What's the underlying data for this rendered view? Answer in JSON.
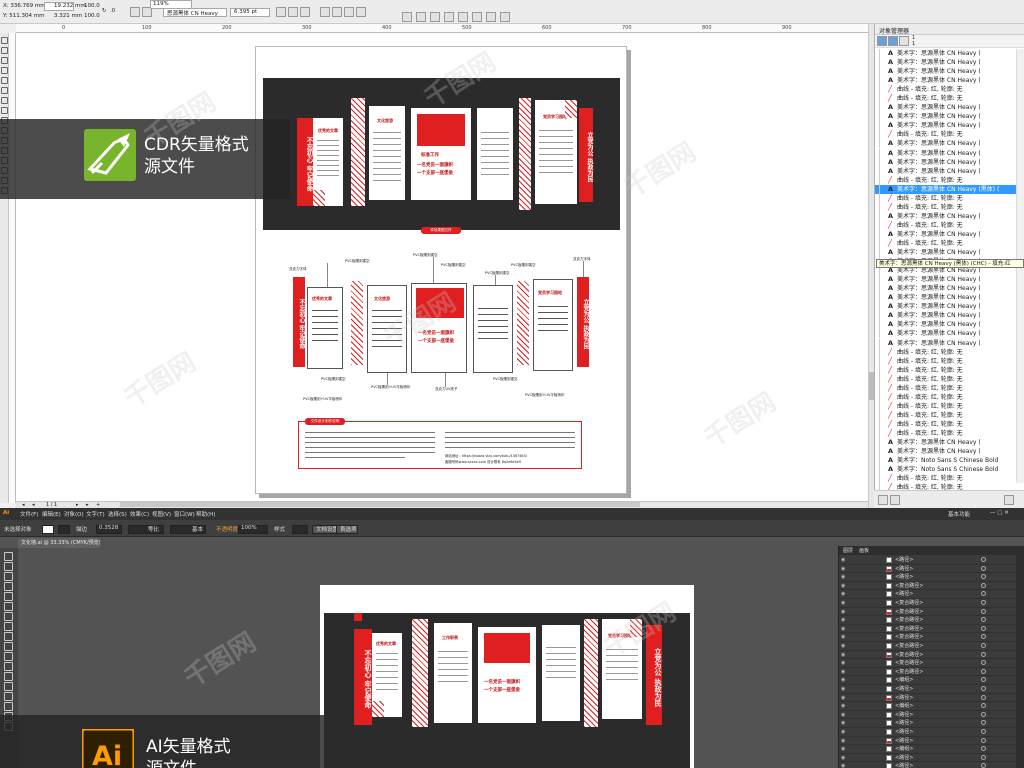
{
  "cdr": {
    "property_bar": {
      "pos_x": "X: 336.769 mm",
      "pos_y": "Y: 511.304 mm",
      "size_w": "19.232 mm",
      "size_h": "3.321 mm",
      "scale_w": "100.0",
      "scale_h": "100.0",
      "rotation": ".0",
      "font_name": "思源黑体 CN Heavy",
      "font_size": "6.395 pt",
      "zoom": "119%"
    },
    "ruler_h": [
      "0",
      "100",
      "200",
      "300",
      "400",
      "500",
      "600",
      "700",
      "800",
      "900"
    ],
    "ruler_v_mm": [
      "800",
      "700",
      "600",
      "500",
      "400",
      "300",
      "200",
      "100"
    ],
    "page_nav": {
      "current": "1 / 1"
    },
    "design": {
      "top_left_vertical": "不忘初心 牢记使命",
      "top_right_vertical": "立党为公 执政为民",
      "panel_titles": [
        "优秀的文章",
        "文化旅游",
        "标准工作",
        "党员学习园地"
      ],
      "center_slogan_1": "一名党员一面旗帜",
      "center_slogan_2": "一个支部一座堡垒",
      "section_label": "本效果图文件",
      "annotation_pvc": "PVC板雕刻镂空",
      "annotation_uv": "PVC板雕刻+UV平板喷印",
      "annotation_material": "亚克力喷漆",
      "annotation_base": "亚克力字体",
      "annotation_center": "亚克力UV底子",
      "notes_title": "文件设计制作说明",
      "notes_url": "网站地址：https://kuaao.ylzu.com/tubu/1387463/",
      "notes_contact": "客服号码www.xxxxx.com  设计联系 6q2e6e5e9"
    },
    "object_manager": {
      "title": "对象管理器",
      "top_layer_1": "1",
      "top_layer_2": "1",
      "tooltip": "美术字：思源黑体 CN Heavy (黑体) (CHC) - 填充:红",
      "selected_index": 15,
      "rows": [
        {
          "type": "text",
          "label": "美术字：思源黑体 CN Heavy ("
        },
        {
          "type": "text",
          "label": "美术字：思源黑体 CN Heavy ("
        },
        {
          "type": "text",
          "label": "美术字：思源黑体 CN Heavy ("
        },
        {
          "type": "text",
          "label": "美术字：思源黑体 CN Heavy ("
        },
        {
          "type": "curve",
          "label": "曲线 - 填充: 红, 轮廓: 无"
        },
        {
          "type": "curve",
          "label": "曲线 - 填充: 红, 轮廓: 无"
        },
        {
          "type": "text",
          "label": "美术字：思源黑体 CN Heavy ("
        },
        {
          "type": "text",
          "label": "美术字：思源黑体 CN Heavy ("
        },
        {
          "type": "text",
          "label": "美术字：思源黑体 CN Heavy ("
        },
        {
          "type": "curve",
          "label": "曲线 - 填充: 红, 轮廓: 无"
        },
        {
          "type": "text",
          "label": "美术字：思源黑体 CN Heavy ("
        },
        {
          "type": "text",
          "label": "美术字：思源黑体 CN Heavy ("
        },
        {
          "type": "text",
          "label": "美术字：思源黑体 CN Heavy ("
        },
        {
          "type": "text",
          "label": "美术字：思源黑体 CN Heavy ("
        },
        {
          "type": "curve",
          "label": "曲线 - 填充: 红, 轮廓: 无"
        },
        {
          "type": "text",
          "label": "美术字：思源黑体 CN Heavy (黑体) ("
        },
        {
          "type": "curve",
          "label": "曲线 - 填充: 红, 轮廓: 无"
        },
        {
          "type": "curve",
          "label": "曲线 - 填充: 红, 轮廓: 无"
        },
        {
          "type": "text",
          "label": "美术字：思源黑体 CN Heavy ("
        },
        {
          "type": "curve",
          "label": "曲线 - 填充: 红, 轮廓: 无"
        },
        {
          "type": "text",
          "label": "美术字：思源黑体 CN Heavy ("
        },
        {
          "type": "curve",
          "label": "曲线 - 填充: 红, 轮廓: 无"
        },
        {
          "type": "text",
          "label": "美术字：思源黑体 CN Heavy ("
        },
        {
          "type": "text",
          "label": "美术字：思源黑体 CN Heavy ("
        },
        {
          "type": "text",
          "label": "美术字：思源黑体 CN Heavy ("
        },
        {
          "type": "text",
          "label": "美术字：思源黑体 CN Heavy ("
        },
        {
          "type": "text",
          "label": "美术字：思源黑体 CN Heavy ("
        },
        {
          "type": "text",
          "label": "美术字：思源黑体 CN Heavy ("
        },
        {
          "type": "text",
          "label": "美术字：思源黑体 CN Heavy ("
        },
        {
          "type": "text",
          "label": "美术字：思源黑体 CN Heavy ("
        },
        {
          "type": "text",
          "label": "美术字：思源黑体 CN Heavy ("
        },
        {
          "type": "text",
          "label": "美术字：思源黑体 CN Heavy ("
        },
        {
          "type": "text",
          "label": "美术字：思源黑体 CN Heavy ("
        },
        {
          "type": "curve",
          "label": "曲线 - 填充: 红, 轮廓: 无"
        },
        {
          "type": "curve",
          "label": "曲线 - 填充: 红, 轮廓: 无"
        },
        {
          "type": "curve",
          "label": "曲线 - 填充: 红, 轮廓: 无"
        },
        {
          "type": "curve",
          "label": "曲线 - 填充: 红, 轮廓: 无"
        },
        {
          "type": "curve",
          "label": "曲线 - 填充: 红, 轮廓: 无"
        },
        {
          "type": "curve",
          "label": "曲线 - 填充: 红, 轮廓: 无"
        },
        {
          "type": "curve",
          "label": "曲线 - 填充: 红, 轮廓: 无"
        },
        {
          "type": "curve",
          "label": "曲线 - 填充: 红, 轮廓: 无"
        },
        {
          "type": "curve",
          "label": "曲线 - 填充: 红, 轮廓: 无"
        },
        {
          "type": "curve",
          "label": "曲线 - 填充: 红, 轮廓: 无"
        },
        {
          "type": "text",
          "label": "美术字：思源黑体 CN Heavy ("
        },
        {
          "type": "text",
          "label": "美术字：思源黑体 CN Heavy ("
        },
        {
          "type": "text",
          "label": "美术字：Noto Sans S Chinese Bold"
        },
        {
          "type": "text",
          "label": "美术字：Noto Sans S Chinese Bold"
        },
        {
          "type": "curve",
          "label": "曲线 - 填充: 红, 轮廓: 无"
        },
        {
          "type": "curve",
          "label": "曲线 - 填充: 红, 轮廓: 无"
        },
        {
          "type": "curve",
          "label": "曲线 - 填充: 红, 轮廓: 无"
        },
        {
          "type": "text",
          "label": "美术字：思源黑体 CN Heavy ("
        },
        {
          "type": "text",
          "label": "美术字：思源黑体 CN Heavy ("
        },
        {
          "type": "curve",
          "label": "曲线 - 填充: 红, 轮廓: 无"
        },
        {
          "type": "text",
          "label": "美术字：思源黑体 Heavy (黑体) (CHC"
        }
      ]
    },
    "overlay_label": "CDR矢量格式\n源文件"
  },
  "ai": {
    "menu": [
      "Ai",
      "文件(F)",
      "编辑(E)",
      "对象(O)",
      "文字(T)",
      "选择(S)",
      "效果(C)",
      "视图(V)",
      "窗口(W)",
      "帮助(H)"
    ],
    "workspace": "基本功能",
    "control": {
      "no_selection": "未选择对象",
      "stroke_label": "描边",
      "stroke_value": "0.3528",
      "brush_equal": "等比",
      "brush_basic": "基本",
      "opacity_label": "不透明度",
      "opacity_value": "100%",
      "style_label": "样式",
      "doc_setup": "文档设置",
      "preferences": "首选项"
    },
    "doc_tab": "文化墙.ai @ 33.33% (CMYK/预览)",
    "layers_panel": {
      "tab_1": "图层",
      "tab_2": "画板",
      "rows": [
        "<路径>",
        "<路径>",
        "<路径>",
        "<复合路径>",
        "<路径>",
        "<复合路径>",
        "<复合路径>",
        "<复合路径>",
        "<复合路径>",
        "<复合路径>",
        "<复合路径>",
        "<复合路径>",
        "<复合路径>",
        "<复合路径>",
        "<编组>",
        "<路径>",
        "<路径>",
        "<编组>",
        "<路径>",
        "<路径>",
        "<路径>",
        "<路径>",
        "<编组>",
        "<路径>",
        "<路径>"
      ]
    },
    "design": {
      "left_vertical": "不忘初心 牢记使命",
      "right_vertical": "立党为公 执政为民",
      "panel_titles": [
        "优秀的文章",
        "工作职责",
        "党员学习园地"
      ],
      "center_slogan_1": "一名党员一面旗帜",
      "center_slogan_2": "一个支部一座堡垒"
    },
    "overlay_label": "AI矢量格式\n源文件"
  },
  "colors": {
    "brand_red": "#e02020",
    "dark_bg": "#2b2b2b",
    "cdr_icon_green": "#78b52c",
    "ai_icon_orange": "#ff9a00"
  }
}
